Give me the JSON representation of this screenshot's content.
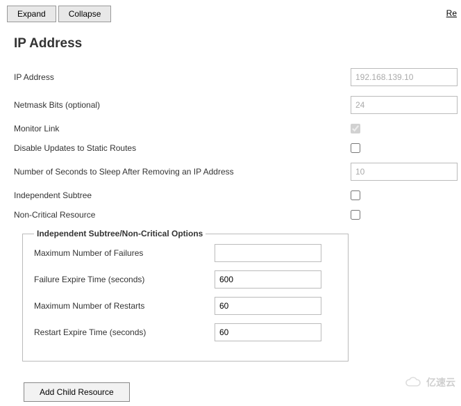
{
  "toolbar": {
    "expand_label": "Expand",
    "collapse_label": "Collapse",
    "right_link": "Re"
  },
  "page": {
    "title": "IP Address"
  },
  "fields": {
    "ip_address": {
      "label": "IP Address",
      "value": "192.168.139.10"
    },
    "netmask": {
      "label": "Netmask Bits (optional)",
      "value": "24"
    },
    "monitor": {
      "label": "Monitor Link",
      "checked": true
    },
    "disable_updates": {
      "label": "Disable Updates to Static Routes",
      "checked": false
    },
    "sleep_seconds": {
      "label": "Number of Seconds to Sleep After Removing an IP Address",
      "value": "10"
    },
    "indep_subtree": {
      "label": "Independent Subtree",
      "checked": false
    },
    "non_critical": {
      "label": "Non-Critical Resource",
      "checked": false
    }
  },
  "subtree_box": {
    "legend": "Independent Subtree/Non-Critical Options",
    "max_failures": {
      "label": "Maximum Number of Failures",
      "value": ""
    },
    "failure_expire": {
      "label": "Failure Expire Time (seconds)",
      "value": "600"
    },
    "max_restarts": {
      "label": "Maximum Number of Restarts",
      "value": "60"
    },
    "restart_expire": {
      "label": "Restart Expire Time (seconds)",
      "value": "60"
    }
  },
  "actions": {
    "add_child_label": "Add Child Resource"
  },
  "watermark": "亿速云"
}
